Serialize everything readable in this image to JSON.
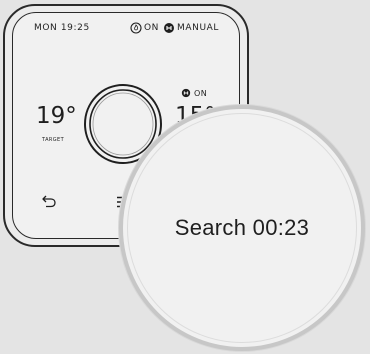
{
  "device": {
    "time": "MON 19:25",
    "heating_status": "ON",
    "mode": "MANUAL",
    "hot_water_status": "ON",
    "target_temp": "19°",
    "target_label": "TARGET",
    "current_temp": "15°"
  },
  "search": {
    "label": "Search 00:23"
  },
  "icons": {
    "flame": "flame-icon",
    "water": "hot-water-icon",
    "back": "back-arrow-icon",
    "menu": "menu-icon"
  },
  "colors": {
    "background": "#e4e4e4",
    "screen": "#f1f1f1",
    "ink": "#1f1f1f",
    "lens_border": "#c7c7c7"
  }
}
